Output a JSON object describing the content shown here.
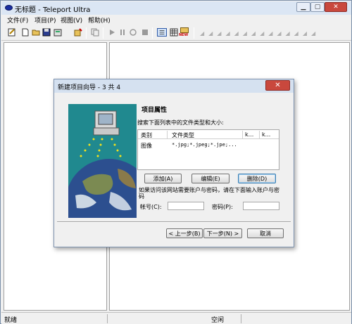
{
  "window": {
    "title": "无标题 - Teleport Ultra",
    "min_glyph": "▁",
    "max_glyph": "▢",
    "close_glyph": "✕"
  },
  "menu": [
    "文件(F)",
    "项目(P)",
    "视图(V)",
    "帮助(H)"
  ],
  "toolbar": {
    "icons": [
      "edit-icon",
      "new-file-icon",
      "open-folder-icon",
      "save-icon",
      "properties-icon",
      "wizard-icon",
      "copy-icon",
      "play-icon",
      "pause-icon",
      "record-icon",
      "stop-icon",
      "list-view-icon",
      "grid-view-icon",
      "new-badge-icon"
    ],
    "new_badge_text": "NEW"
  },
  "status": {
    "left": "就绪",
    "middle": "空闲"
  },
  "dialog": {
    "title": "新建项目向导 - 3 共 4",
    "close_glyph": "✕",
    "heading": "项目属性",
    "instruction": "搜索下面列表中的文件类型和大小:",
    "table": {
      "headers": [
        "类别",
        "文件类型",
        "k...",
        "k..."
      ],
      "rows": [
        {
          "category": "图像",
          "types": "*.jpg;*.jpeg;*.jpe;..."
        }
      ]
    },
    "buttons": {
      "add": "添加(A)",
      "edit": "编辑(E)",
      "delete": "删除(D)"
    },
    "account_note": "如果访问该网站需要账户与密码，请在下面输入账户与密码",
    "account_label": "帐号(C):",
    "account_value": "",
    "password_label": "密码(P):",
    "password_value": "",
    "back": "< 上一步(B)",
    "next": "下一步(N) >",
    "cancel": "取消"
  },
  "colors": {
    "teal": "#20898f",
    "close_red": "#c9483d",
    "title_blue": "#dbe6f4"
  }
}
